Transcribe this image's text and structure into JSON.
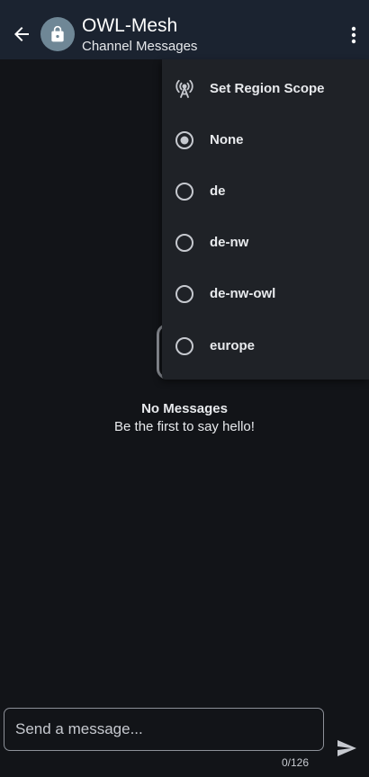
{
  "header": {
    "title": "OWL-Mesh",
    "subtitle": "Channel Messages",
    "icons": {
      "back": "arrow-left-icon",
      "avatar": "lock-icon",
      "menu": "more-vertical-icon"
    }
  },
  "menu": {
    "title": "Set Region Scope",
    "title_icon": "antenna-icon",
    "options": [
      {
        "label": "None",
        "selected": true
      },
      {
        "label": "de",
        "selected": false
      },
      {
        "label": "de-nw",
        "selected": false
      },
      {
        "label": "de-nw-owl",
        "selected": false
      },
      {
        "label": "europe",
        "selected": false
      }
    ]
  },
  "empty_state": {
    "title": "No Messages",
    "subtitle": "Be the first to say hello!"
  },
  "composer": {
    "placeholder": "Send a message...",
    "counter": "0/126",
    "send_icon": "send-icon"
  },
  "colors": {
    "background": "#121418",
    "appbar": "#1b2330",
    "menu": "#1f2227",
    "avatar": "#6f8796",
    "text": "#e8eaed"
  }
}
